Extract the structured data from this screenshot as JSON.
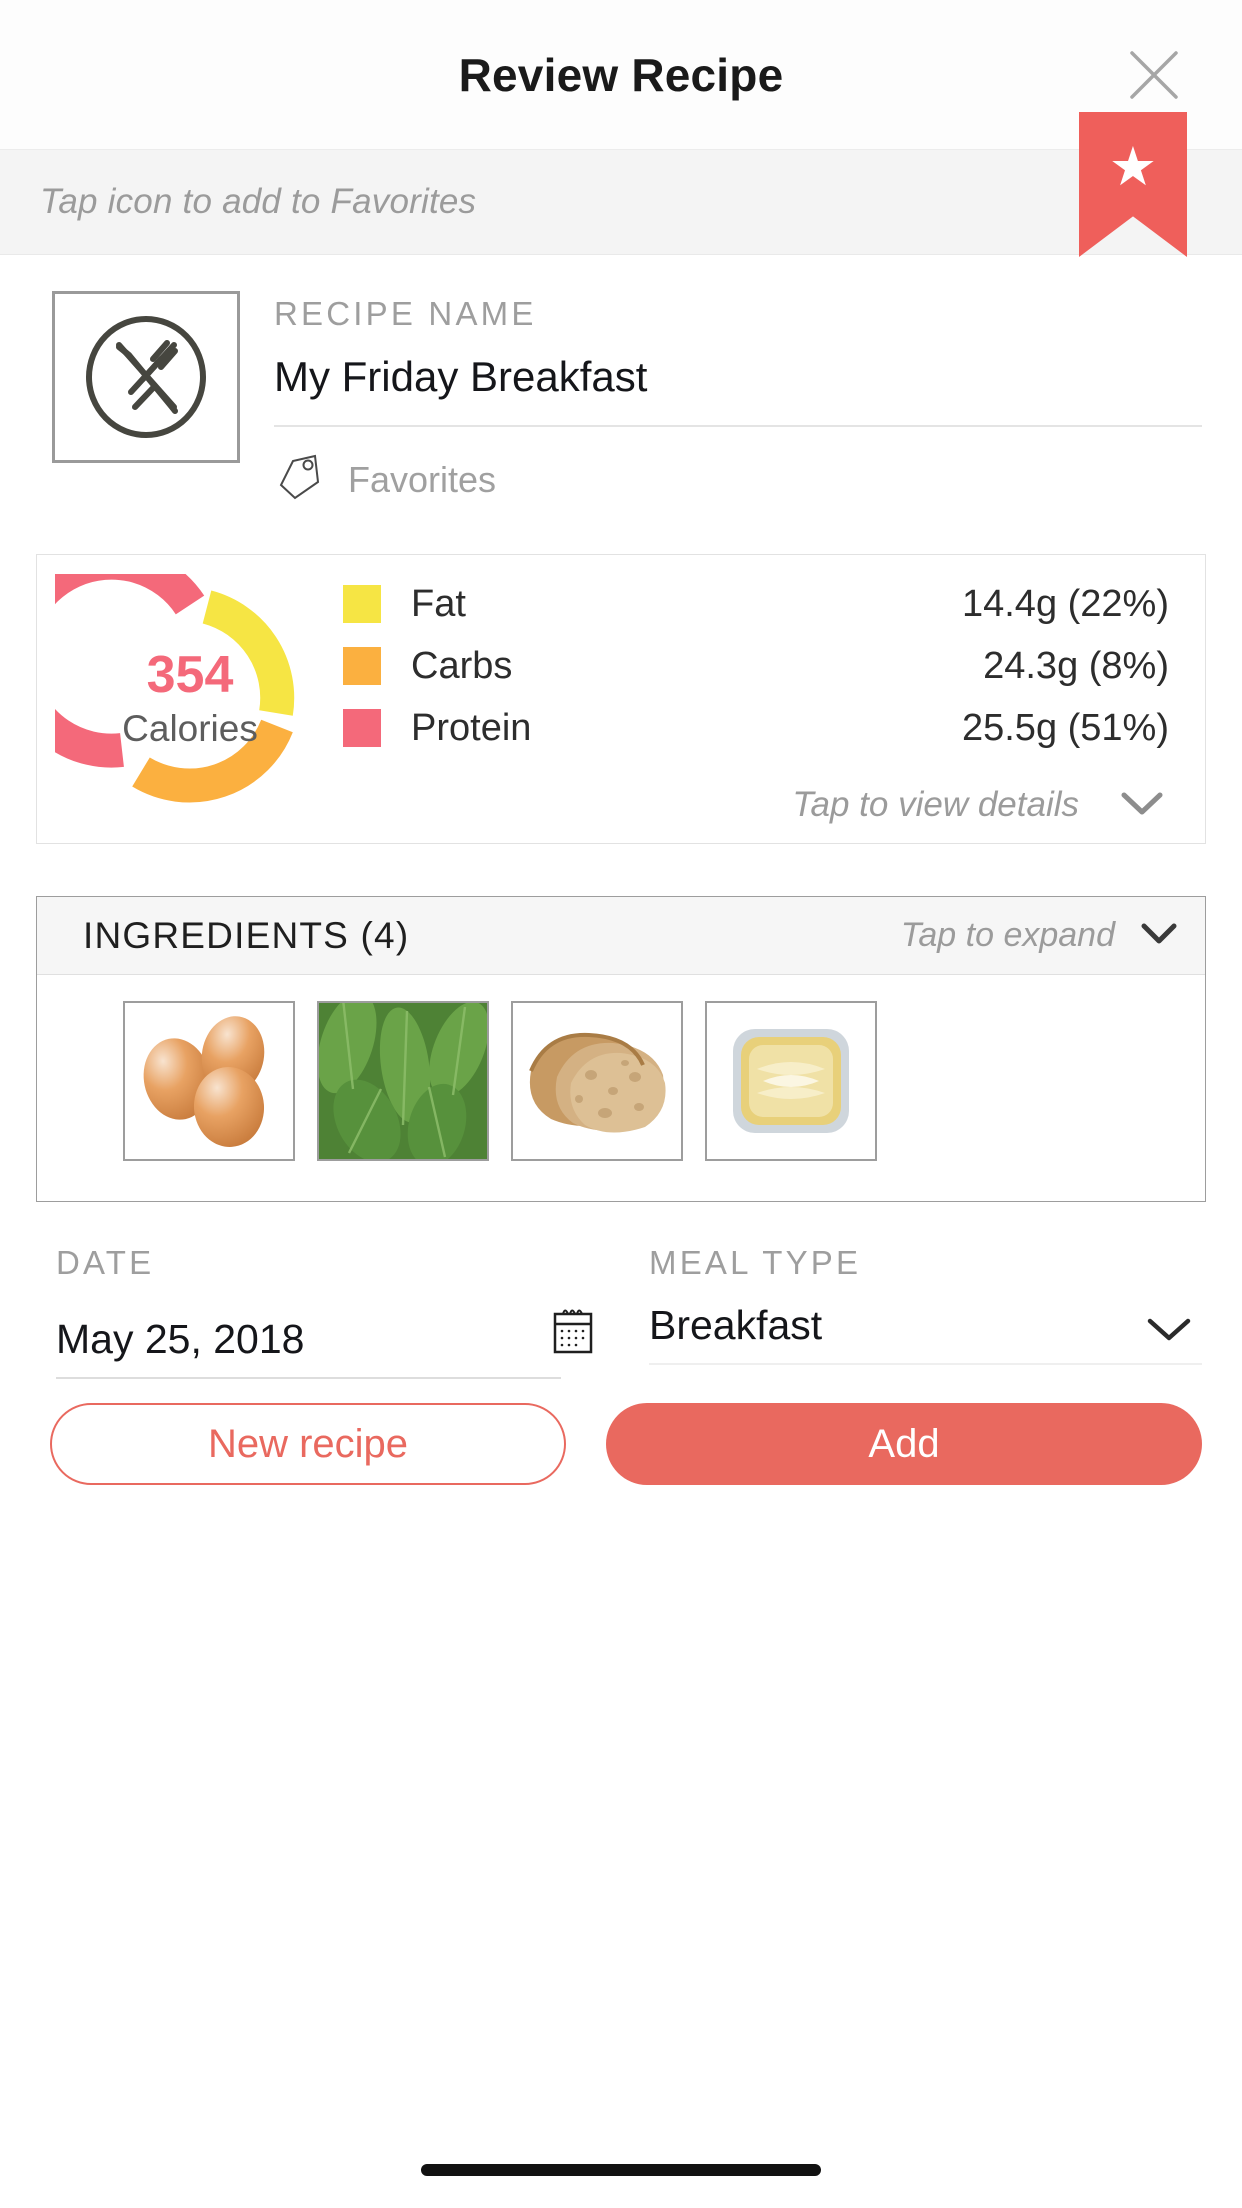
{
  "header": {
    "title": "Review Recipe",
    "close_icon": "close-icon"
  },
  "favorites_strip": {
    "hint": "Tap icon to add to Favorites",
    "ribbon_icon": "star-icon",
    "ribbon_color": "#ef5f5b"
  },
  "recipe": {
    "image_icon": "plate-cutlery-icon",
    "name_label": "RECIPE NAME",
    "name_value": "My Friday Breakfast",
    "tag_icon": "tag-icon",
    "tag_label": "Favorites"
  },
  "nutrition": {
    "calories_value": "354",
    "calories_label": "Calories",
    "details_text": "Tap to view details",
    "details_chevron": "chevron-down-icon",
    "legend": [
      {
        "name": "Fat",
        "value": "14.4g (22%)",
        "color": "#f6e544"
      },
      {
        "name": "Carbs",
        "value": "24.3g (8%)",
        "color": "#fbb košt"
      },
      {
        "name": "Protein",
        "value": "25.5g (51%)",
        "color": "#f4697a"
      }
    ]
  },
  "chart_data": {
    "type": "pie",
    "title": "354 Calories",
    "categories": [
      "Fat",
      "Carbs",
      "Protein"
    ],
    "values": [
      22,
      8,
      51
    ],
    "grams": [
      14.4,
      24.3,
      25.5
    ],
    "units": "g",
    "percent_labels": [
      "22%",
      "8%",
      "51%"
    ],
    "colors": [
      "#f6e544",
      "#fbb040",
      "#f4697a"
    ],
    "center_value": 354,
    "center_label": "Calories",
    "legend_position": "right",
    "donut": true,
    "segment_degrees": [
      95,
      120,
      125
    ],
    "start_angle_deg": 0,
    "gap_deg": 8
  },
  "ingredients": {
    "title": "INGREDIENTS (4)",
    "expand_text": "Tap to expand",
    "expand_chevron": "chevron-down-icon",
    "items": [
      {
        "name": "eggs-thumbnail"
      },
      {
        "name": "spinach-thumbnail"
      },
      {
        "name": "bread-thumbnail"
      },
      {
        "name": "butter-thumbnail"
      }
    ]
  },
  "footer": {
    "date_label": "DATE",
    "date_value": "May 25, 2018",
    "calendar_icon": "calendar-icon",
    "meal_label": "MEAL TYPE",
    "meal_value": "Breakfast",
    "meal_chevron": "chevron-down-icon"
  },
  "actions": {
    "secondary_label": "New recipe",
    "primary_label": "Add",
    "accent_color": "#e9695f"
  }
}
